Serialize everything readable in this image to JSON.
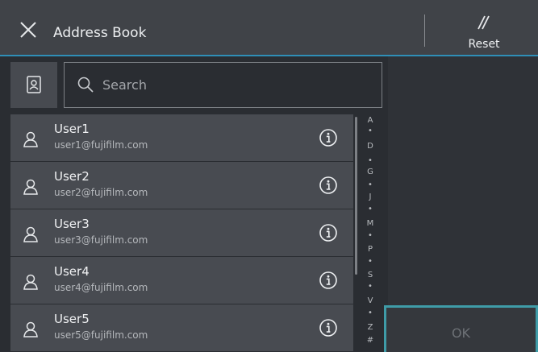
{
  "header": {
    "title": "Address Book",
    "reset_label": "Reset",
    "close_icon": "close-icon",
    "reset_icon": "reset-icon"
  },
  "search": {
    "placeholder": "Search",
    "address_icon": "address-book-icon"
  },
  "contacts": [
    {
      "name": "User1",
      "email": "user1@fujifilm.com"
    },
    {
      "name": "User2",
      "email": "user2@fujifilm.com"
    },
    {
      "name": "User3",
      "email": "user3@fujifilm.com"
    },
    {
      "name": "User4",
      "email": "user4@fujifilm.com"
    },
    {
      "name": "User5",
      "email": "user5@fujifilm.com"
    }
  ],
  "index": [
    "A",
    "•",
    "D",
    "•",
    "G",
    "•",
    "J",
    "•",
    "M",
    "•",
    "P",
    "•",
    "S",
    "•",
    "V",
    "•",
    "Z",
    "#"
  ],
  "footer": {
    "ok_label": "OK"
  },
  "colors": {
    "accent": "#2f8fb7",
    "ok_border": "#3f9ca8",
    "header_bg": "#404348",
    "row_bg": "#484b51"
  }
}
